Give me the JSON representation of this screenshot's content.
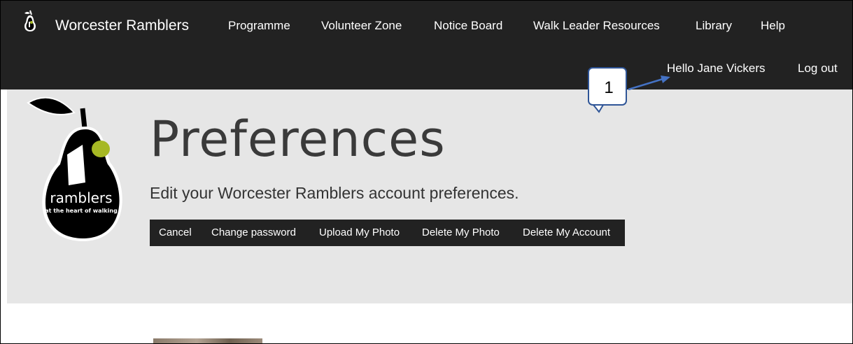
{
  "header": {
    "brand": "Worcester Ramblers",
    "nav": [
      "Programme",
      "Volunteer Zone",
      "Notice Board",
      "Walk Leader Resources",
      "Library",
      "Help"
    ],
    "greeting": "Hello Jane Vickers",
    "logout": "Log out"
  },
  "logo": {
    "line1": "ramblers",
    "line2": "at the heart of walking"
  },
  "page": {
    "title": "Preferences",
    "subtitle": "Edit your Worcester Ramblers account preferences."
  },
  "actions": [
    "Cancel",
    "Change password",
    "Upload My Photo",
    "Delete My Photo",
    "Delete My Account"
  ],
  "annotation": {
    "label": "1"
  },
  "colors": {
    "topbar": "#222222",
    "hero": "#e6e6e6",
    "accent_green": "#a6b824",
    "callout_border": "#2f5597",
    "arrow": "#4472c4"
  }
}
